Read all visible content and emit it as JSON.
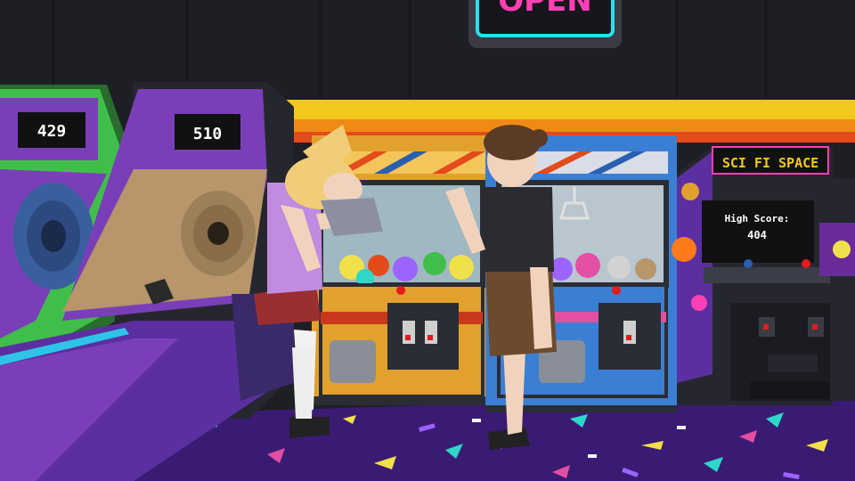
{
  "scene": {
    "setting": "arcade",
    "neon_sign": {
      "text": "OPEN",
      "color": "#ff3fb4",
      "frame_color": "#28e0f0"
    },
    "skeeball_left": {
      "score": "429"
    },
    "skeeball_right": {
      "score": "510"
    },
    "arcade_cabinet": {
      "marquee": "SCI FI SPACE",
      "screen_line1": "High Score:",
      "screen_line2": "404"
    },
    "claw_machine_left": {
      "color": "#e2a02c"
    },
    "claw_machine_right": {
      "color": "#3b7fd4"
    }
  },
  "colors": {
    "wall": "#1e1f25",
    "stripe_yellow": "#f2c81d",
    "stripe_orange": "#ef8b15",
    "stripe_red": "#e44b1a",
    "carpet": "#3a1b73",
    "skeeball_purple": "#7a3fb8",
    "skeeball_green": "#3fbf4a"
  }
}
